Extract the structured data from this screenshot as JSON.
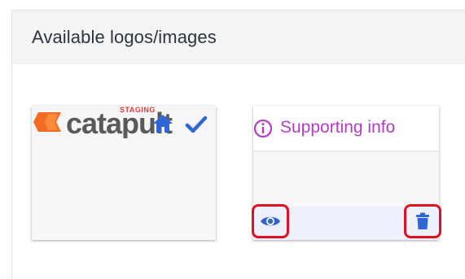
{
  "panel": {
    "title": "Available logos/images"
  },
  "cards": [
    {
      "logo_text": "catapult",
      "staging_label": "STAGING",
      "icons": [
        "home-icon",
        "check-icon"
      ]
    },
    {
      "title": "Supporting info",
      "icons": [
        "info-icon",
        "eye-icon",
        "trash-icon"
      ]
    }
  ],
  "colors": {
    "accent_blue": "#2f66d6",
    "supporting_text": "#b53bc6",
    "highlight_red": "#e01020",
    "logo_orange": "#f26b21"
  }
}
